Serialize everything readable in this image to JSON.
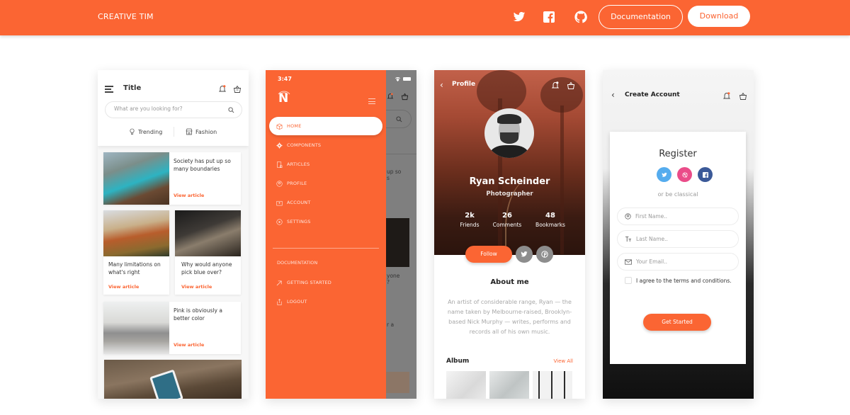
{
  "topbar": {
    "brand": "CREATIVE TIM",
    "icons": [
      "twitter-icon",
      "facebook-icon",
      "github-icon"
    ],
    "documentation_label": "Documentation",
    "download_label": "Download",
    "accent": "#fb6533"
  },
  "phone1": {
    "title": "Title",
    "search_placeholder": "What are you looking for?",
    "tabs": [
      {
        "label": "Trending",
        "icon": "lightbulb-icon"
      },
      {
        "label": "Fashion",
        "icon": "shop-icon"
      }
    ],
    "articles": [
      {
        "title": "Society has put up so many boundaries",
        "link": "View article"
      },
      {
        "title": "Many limitations on what's right",
        "link": "View article"
      },
      {
        "title": "Why would anyone pick blue over?",
        "link": "View article"
      },
      {
        "title": "Pink is obviously a better color",
        "link": "View article"
      }
    ]
  },
  "phone2": {
    "time": "3:47",
    "logo": "N",
    "menu": [
      {
        "label": "HOME",
        "icon": "box-icon",
        "active": true
      },
      {
        "label": "COMPONENTS",
        "icon": "gear-icon"
      },
      {
        "label": "ARTICLES",
        "icon": "article-icon"
      },
      {
        "label": "PROFILE",
        "icon": "profile-icon"
      },
      {
        "label": "ACCOUNT",
        "icon": "account-icon"
      },
      {
        "label": "SETTINGS",
        "icon": "settings-icon"
      }
    ],
    "section_label": "DOCUMENTATION",
    "doc_menu": [
      {
        "label": "GETTING STARTED",
        "icon": "spaceship-icon"
      },
      {
        "label": "LOGOUT",
        "icon": "logout-icon"
      }
    ],
    "background_text": [
      "up so",
      "s",
      "yone",
      "?",
      "r a"
    ]
  },
  "phone3": {
    "header_title": "Profile",
    "name": "Ryan Scheinder",
    "role": "Photographer",
    "stats": [
      {
        "value": "2k",
        "label": "Friends"
      },
      {
        "value": "26",
        "label": "Comments"
      },
      {
        "value": "48",
        "label": "Bookmarks"
      }
    ],
    "follow_label": "Follow",
    "about_title": "About me",
    "about_text": "An artist of considerable range, Ryan — the name taken by Melbourne-raised, Brooklyn-based Nick Murphy — writes, performs and records all of his own music.",
    "album_title": "Album",
    "view_all": "View All"
  },
  "phone4": {
    "header_title": "Create Account",
    "register_title": "Register",
    "social": [
      {
        "name": "twitter",
        "color": "#55acee"
      },
      {
        "name": "dribbble",
        "color": "#ea4c89"
      },
      {
        "name": "facebook",
        "color": "#3b5998"
      }
    ],
    "or_text": "or be classical",
    "fields": [
      {
        "placeholder": "First Name..",
        "icon": "user-icon"
      },
      {
        "placeholder": "Last Name..",
        "icon": "text-icon"
      },
      {
        "placeholder": "Your Email..",
        "icon": "email-icon"
      }
    ],
    "terms": "I agree to the terms and conditions.",
    "submit_label": "Get Started"
  }
}
